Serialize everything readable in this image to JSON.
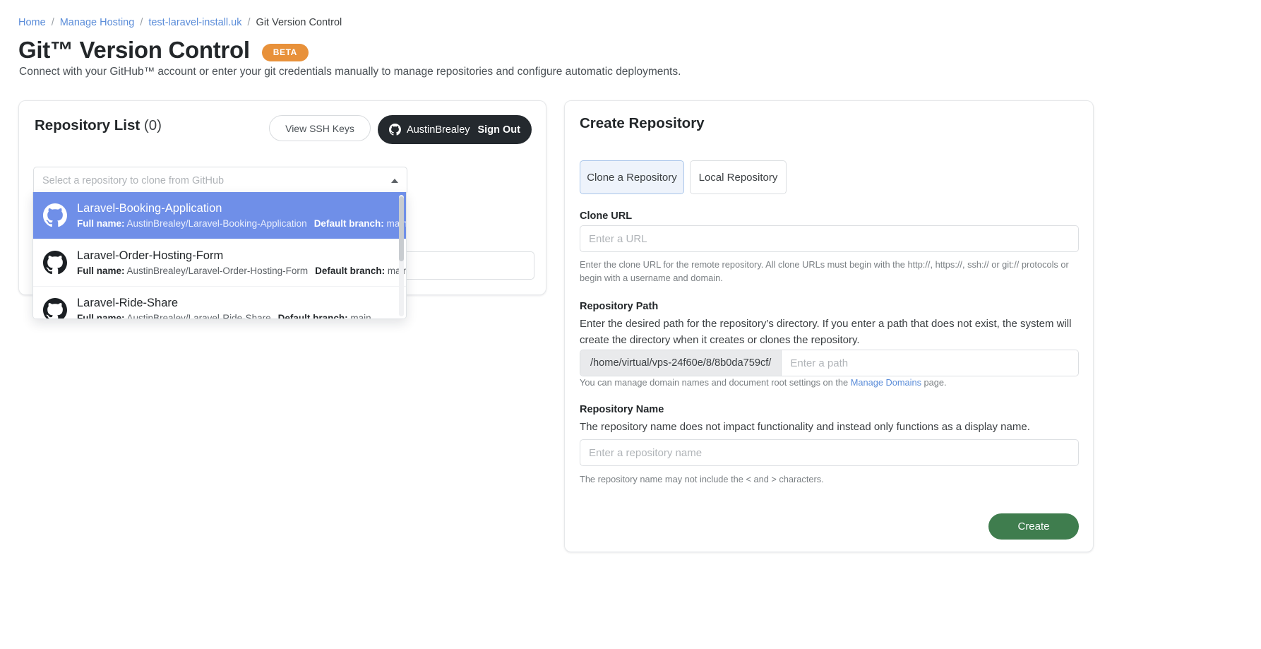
{
  "breadcrumb": {
    "items": [
      {
        "label": "Home",
        "link": true
      },
      {
        "label": "Manage Hosting",
        "link": true
      },
      {
        "label": "test-laravel-install.uk",
        "link": true
      },
      {
        "label": "Git Version Control",
        "link": false
      }
    ],
    "separator": "/"
  },
  "header": {
    "title": "Git™ Version Control",
    "badge": "BETA",
    "badge_color": "#e8913a",
    "subtitle": "Connect with your GitHub™ account or enter your git credentials manually to manage repositories and configure automatic deployments."
  },
  "repository_list": {
    "title": "Repository List",
    "count": "(0)",
    "ssh_keys_button": "View SSH Keys",
    "github_account": "AustinBrealey",
    "sign_out_label": "Sign Out",
    "github_icon": "github-mark-icon",
    "select": {
      "placeholder": "Select a repository to clone from GitHub",
      "caret_icon": "caret-up-icon",
      "expanded": true
    },
    "options": [
      {
        "name": "Laravel-Booking-Application",
        "full_name_label": "Full name:",
        "full_name": "AustinBrealey/Laravel-Booking-Application",
        "branch_label": "Default branch:",
        "branch": "main",
        "selected": true,
        "icon": "github-mark-icon"
      },
      {
        "name": "Laravel-Order-Hosting-Form",
        "full_name_label": "Full name:",
        "full_name": "AustinBrealey/Laravel-Order-Hosting-Form",
        "branch_label": "Default branch:",
        "branch": "main",
        "selected": false,
        "icon": "github-mark-icon"
      },
      {
        "name": "Laravel-Ride-Share",
        "full_name_label": "Full name:",
        "full_name": "AustinBrealey/Laravel-Ride-Share",
        "branch_label": "Default branch:",
        "branch": "main",
        "selected": false,
        "icon": "github-mark-icon"
      }
    ]
  },
  "create_repository": {
    "title": "Create Repository",
    "tabs": [
      {
        "label": "Clone a Repository",
        "active": true
      },
      {
        "label": "Local Repository",
        "active": false
      }
    ],
    "clone_url": {
      "label": "Clone URL",
      "placeholder": "Enter a URL",
      "value": "",
      "hint": "Enter the clone URL for the remote repository. All clone URLs must begin with the http://, https://, ssh:// or git:// protocols or begin with a username and domain."
    },
    "repository_path": {
      "label": "Repository Path",
      "description": "Enter the desired path for the repository’s directory. If you enter a path that does not exist, the system will create the directory when it creates or clones the repository.",
      "prefix": "/home/virtual/vps-24f60e/8/8b0da759cf/",
      "placeholder": "Enter a path",
      "value": "",
      "hint_before": "You can manage domain names and document root settings on the ",
      "hint_link": "Manage Domains",
      "hint_after": " page."
    },
    "repository_name": {
      "label": "Repository Name",
      "description": "The repository name does not impact functionality and instead only functions as a display name.",
      "placeholder": "Enter a repository name",
      "value": "",
      "hint": "The repository name may not include the < and > characters."
    },
    "create_button": "Create",
    "create_button_color": "#3f7d4e"
  }
}
